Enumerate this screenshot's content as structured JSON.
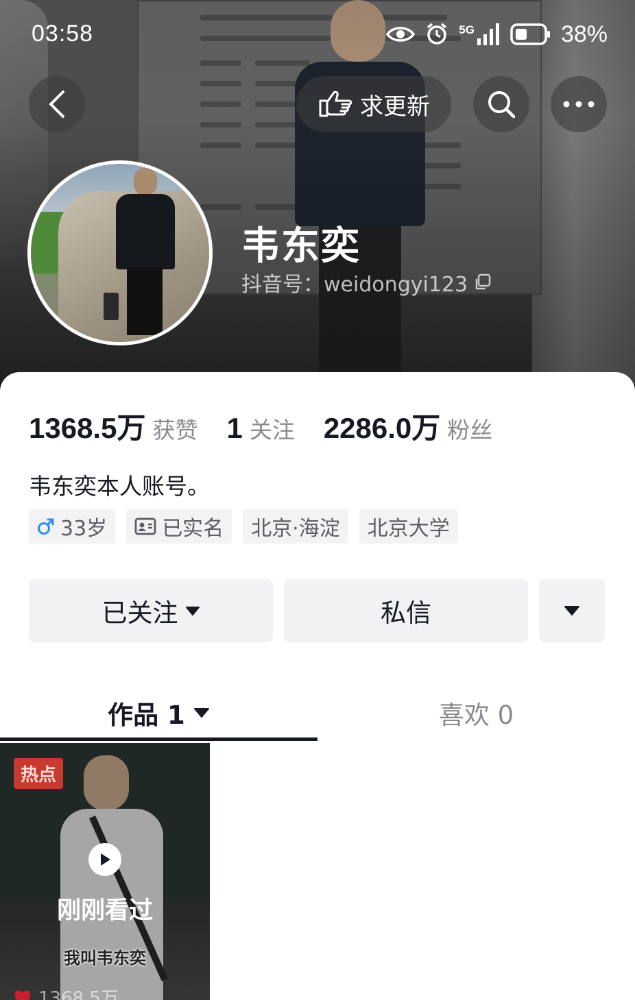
{
  "status_bar": {
    "time": "03:58",
    "network": "5G",
    "battery_percent": "38%"
  },
  "header": {
    "update_request_label": "求更新"
  },
  "profile": {
    "nickname": "韦东奕",
    "douyin_id": "抖音号：weidongyi123",
    "bio": "韦东奕本人账号。"
  },
  "stats": [
    {
      "value": "1368.5万",
      "label": "获赞"
    },
    {
      "value": "1",
      "label": "关注"
    },
    {
      "value": "2286.0万",
      "label": "粉丝"
    }
  ],
  "tags": {
    "age": "33岁",
    "verified": "已实名",
    "location": "北京·海淀",
    "school": "北京大学"
  },
  "actions": {
    "follow_label": "已关注",
    "message_label": "私信"
  },
  "tabs": {
    "works_label": "作品 1",
    "likes_label": "喜欢 0"
  },
  "video": {
    "hot_badge": "热点",
    "overlay_text": "刚刚看过",
    "caption": "我叫韦东奕",
    "likes": "1368.5万"
  },
  "colors": {
    "primary_text": "#161823",
    "secondary_text": "#8a8b91",
    "button_bg": "#f2f2f4",
    "male_icon": "#2d8cf0"
  }
}
